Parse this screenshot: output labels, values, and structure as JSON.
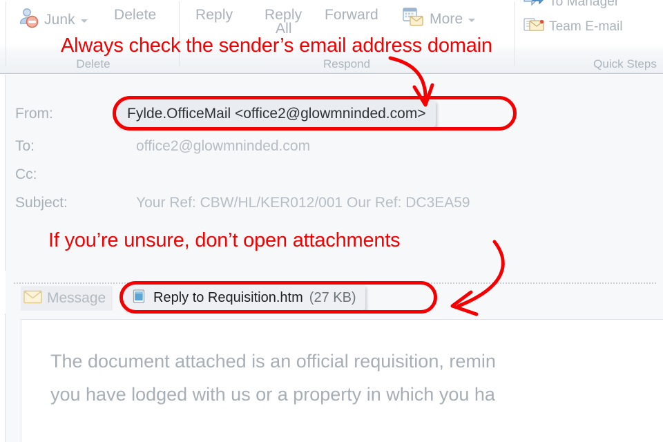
{
  "ribbon": {
    "groups": [
      {
        "label": "Delete",
        "center": 135
      },
      {
        "label": "Respond",
        "center": 502
      },
      {
        "label": "Quick Steps",
        "center": 905
      }
    ],
    "commands": {
      "junk": {
        "label": "Junk",
        "icon": "junk-person-block-icon",
        "has_caret": true
      },
      "delete": {
        "label": "Delete",
        "icon": "delete-icon",
        "has_caret": false
      },
      "reply": {
        "label": "Reply",
        "icon": "reply-icon",
        "has_caret": false
      },
      "reply_all": {
        "label": "Reply",
        "label2": "All",
        "icon": "reply-all-icon",
        "has_caret": false
      },
      "forward": {
        "label": "Forward",
        "icon": "forward-icon",
        "has_caret": false
      },
      "more": {
        "label": "More",
        "icon": "meeting-mail-icon",
        "has_caret": true
      },
      "to_manager": {
        "label": "To Manager",
        "icon": "to-manager-arrow-icon",
        "has_caret": false
      },
      "team_email": {
        "label": "Team E-mail",
        "icon": "team-email-icon",
        "has_caret": false
      }
    }
  },
  "headers": {
    "from_label": "From:",
    "from_value": "Fylde.OfficeMail <office2@glowmninded.com>",
    "to_label": "To:",
    "to_value": "office2@glowmninded.com",
    "cc_label": "Cc:",
    "cc_value": "",
    "subject_label": "Subject:",
    "subject_value": "Your Ref: CBW/HL/KER012/001 Our Ref: DC3EA59"
  },
  "attachments": {
    "tab_label": "Message",
    "tab_icon": "envelope-icon",
    "file_icon": "htm-document-icon",
    "file_name": "Reply to Requisition.htm",
    "file_size": "(27 KB)"
  },
  "body": {
    "line1": "The document attached is an official requisition, remin",
    "line2": "you have lodged with us or a property in which you ha"
  },
  "annotations": {
    "color": "#f40000",
    "note1": "Always check the sender’s email address domain",
    "note2": "If you’re unsure, don’t open attachments"
  }
}
